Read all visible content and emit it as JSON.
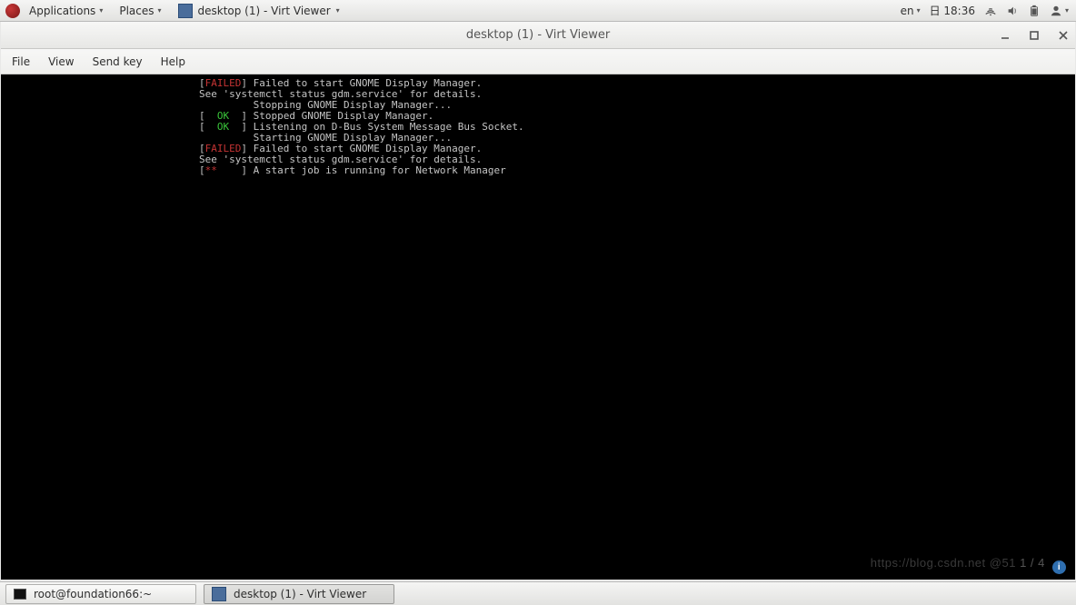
{
  "top_panel": {
    "applications": "Applications",
    "places": "Places",
    "task_title": "desktop (1) - Virt Viewer",
    "locale": "en",
    "clock": "日 18:36"
  },
  "window": {
    "title": "desktop (1) - Virt Viewer",
    "menus": {
      "file": "File",
      "view": "View",
      "sendkey": "Send key",
      "help": "Help"
    }
  },
  "console": {
    "l1_pre": "[",
    "l1_stat": "FAILED",
    "l1_post": "] Failed to start GNOME Display Manager.",
    "l2": "See 'systemctl status gdm.service' for details.",
    "l3": "         Stopping GNOME Display Manager...",
    "l4_pre": "[  ",
    "l4_stat": "OK",
    "l4_post": "  ] Stopped GNOME Display Manager.",
    "l5_pre": "[  ",
    "l5_stat": "OK",
    "l5_post": "  ] Listening on D-Bus System Message Bus Socket.",
    "l6": "         Starting GNOME Display Manager...",
    "l7_pre": "[",
    "l7_stat": "FAILED",
    "l7_post": "] Failed to start GNOME Display Manager.",
    "l8": "See 'systemctl status gdm.service' for details.",
    "l9_pre": "[",
    "l9_spin": "**",
    "l9_post": "    ] A start job is running for Network Manager"
  },
  "watermark": {
    "url": "https://blog.csdn.net",
    "at": "@51",
    "page": "1 / 4"
  },
  "taskbar": {
    "terminal": "root@foundation66:~",
    "app": "desktop (1) - Virt Viewer"
  }
}
